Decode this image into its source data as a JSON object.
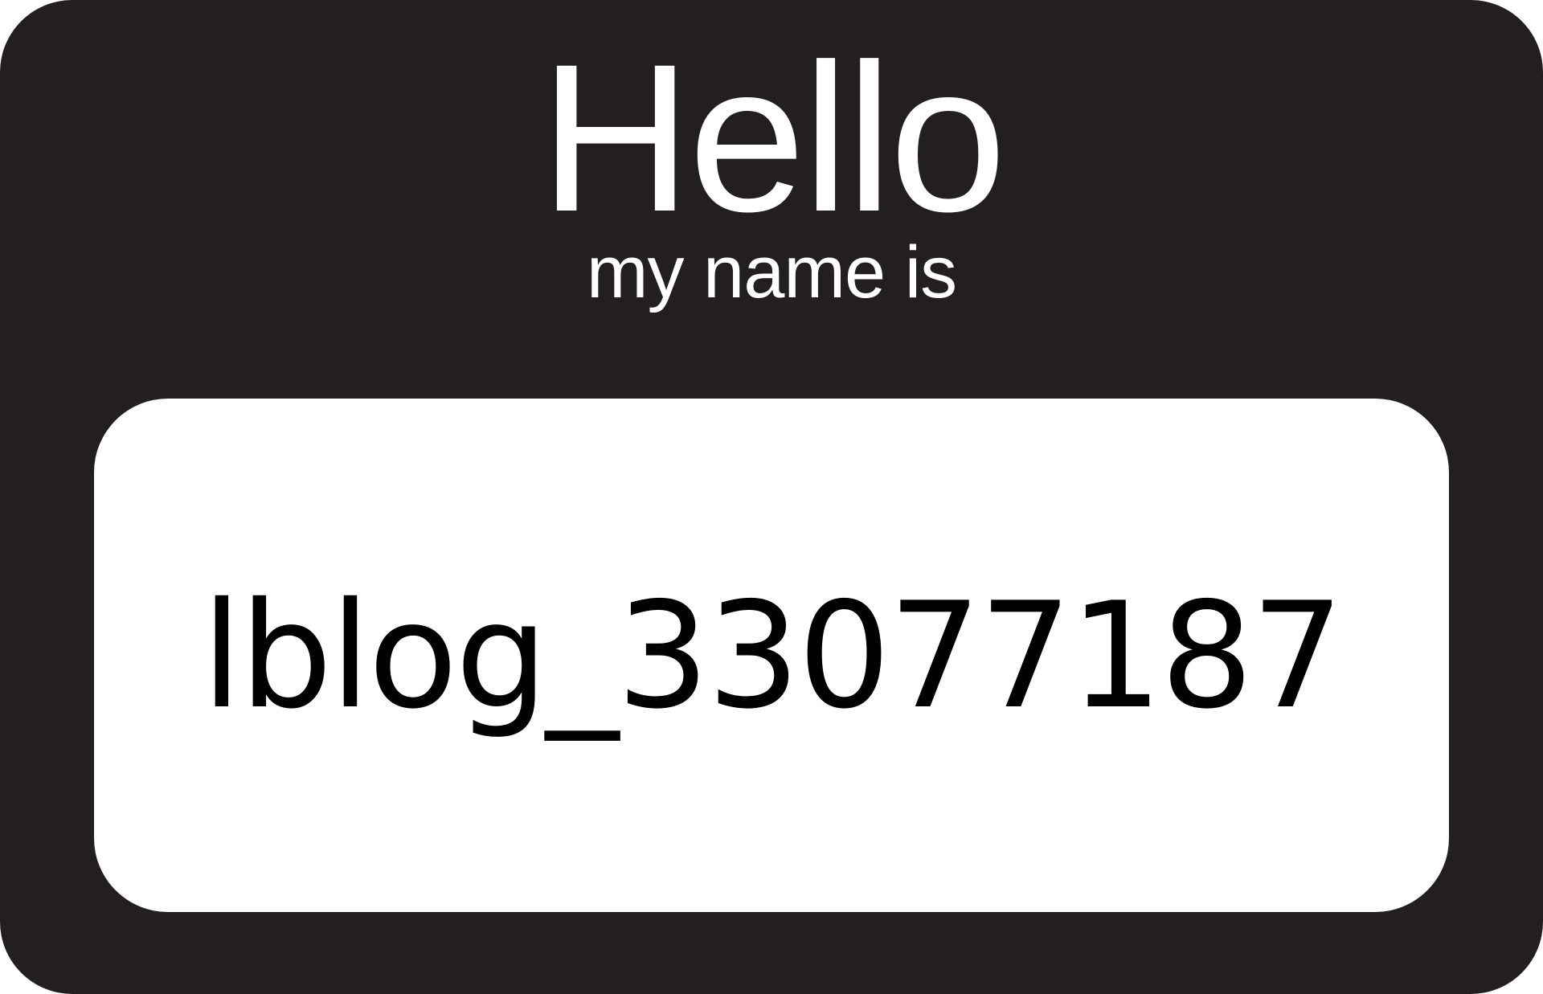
{
  "badge": {
    "greeting": "Hello",
    "subtitle": "my name is",
    "name": "lblog_33077187",
    "colors": {
      "frame": "#231f20",
      "panel": "#ffffff",
      "header_text": "#ffffff",
      "name_text": "#000000"
    }
  }
}
